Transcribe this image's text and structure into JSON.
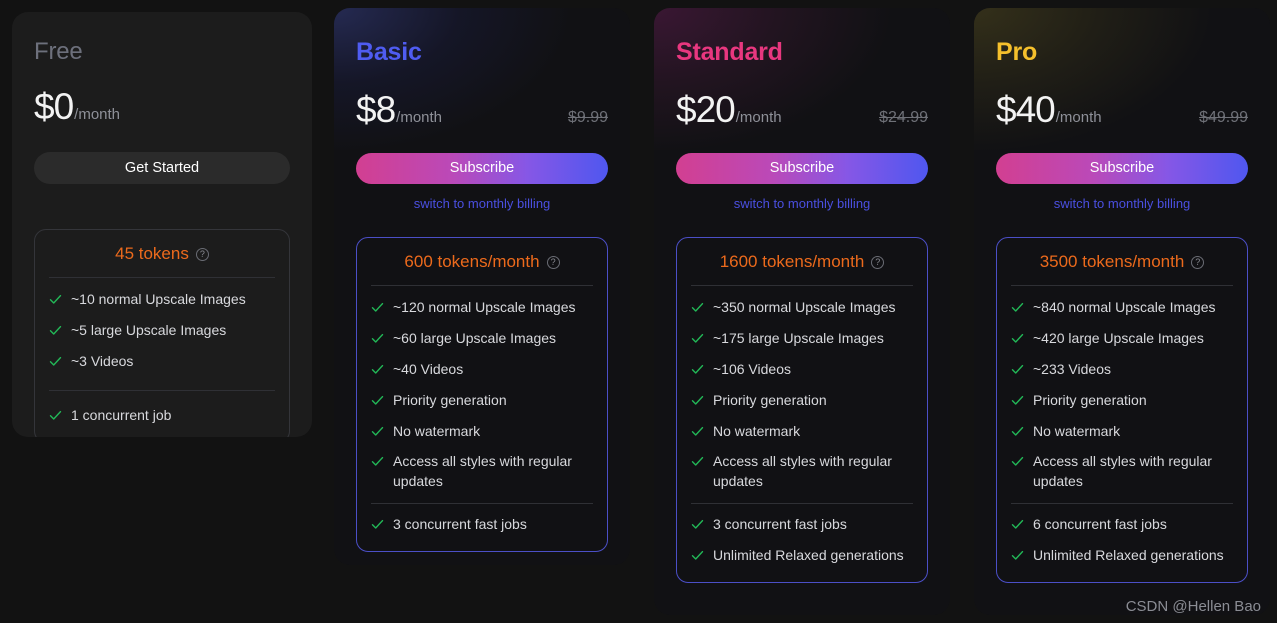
{
  "colors": {
    "accent_orange": "#ec6a1c",
    "check_green": "#22b757",
    "link_blue": "#4a4fe0",
    "gradient_start": "#d23f91",
    "gradient_end": "#4f57ef",
    "title_basic": "#4f5cf1",
    "title_standard": "#e8377f",
    "title_pro": "#f5c02c",
    "panel_border_blue": "#4b4fc7"
  },
  "plans": [
    {
      "id": "free",
      "title": "Free",
      "price": "$0",
      "period": "/month",
      "old_price": "",
      "cta_label": "Get Started",
      "switch_label": "",
      "tokens": "45 tokens",
      "info_icon": "?",
      "features_top": [
        "~10 normal Upscale Images",
        "~5 large Upscale Images",
        "~3 Videos"
      ],
      "features_bottom": [
        "1 concurrent job"
      ]
    },
    {
      "id": "basic",
      "title": "Basic",
      "price": "$8",
      "period": "/month",
      "old_price": "$9.99",
      "cta_label": "Subscribe",
      "switch_label": "switch to monthly billing",
      "tokens": "600 tokens/month",
      "info_icon": "?",
      "features_top": [
        "~120 normal Upscale Images",
        "~60 large Upscale Images",
        "~40 Videos",
        "Priority generation",
        "No watermark",
        "Access all styles with regular updates"
      ],
      "features_bottom": [
        "3 concurrent fast jobs"
      ]
    },
    {
      "id": "standard",
      "title": "Standard",
      "price": "$20",
      "period": "/month",
      "old_price": "$24.99",
      "cta_label": "Subscribe",
      "switch_label": "switch to monthly billing",
      "tokens": "1600 tokens/month",
      "info_icon": "?",
      "features_top": [
        "~350 normal Upscale Images",
        "~175 large Upscale Images",
        "~106 Videos",
        "Priority generation",
        "No watermark",
        "Access all styles with regular updates"
      ],
      "features_bottom": [
        "3 concurrent fast jobs",
        "Unlimited Relaxed generations"
      ]
    },
    {
      "id": "pro",
      "title": "Pro",
      "price": "$40",
      "period": "/month",
      "old_price": "$49.99",
      "cta_label": "Subscribe",
      "switch_label": "switch to monthly billing",
      "tokens": "3500 tokens/month",
      "info_icon": "?",
      "features_top": [
        "~840 normal Upscale Images",
        "~420 large Upscale Images",
        "~233 Videos",
        "Priority generation",
        "No watermark",
        "Access all styles with regular updates"
      ],
      "features_bottom": [
        "6 concurrent fast jobs",
        "Unlimited Relaxed generations"
      ]
    }
  ],
  "watermark": "CSDN @Hellen Bao"
}
